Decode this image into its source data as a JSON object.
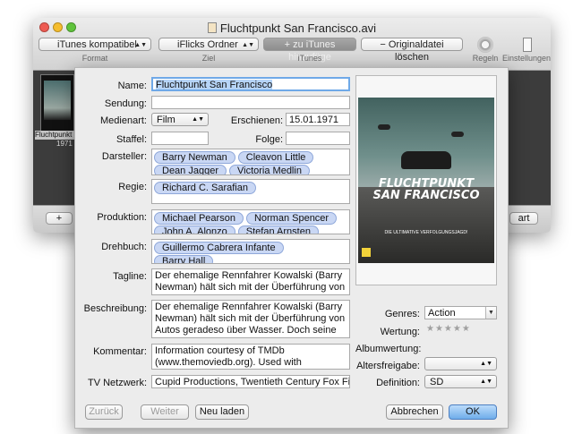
{
  "window": {
    "title": "Fluchtpunkt San Francisco.avi",
    "toolbar": {
      "format_value": "iTunes kompatibel",
      "format_caption": "Format",
      "ziel_value": "iFlicks Ordner",
      "ziel_caption": "Ziel",
      "itunes_add_label": "+ zu iTunes hinzufüge",
      "itunes_caption": "iTunes",
      "delete_original_label": "− Originaldatei löschen",
      "rules_label": "Regeln",
      "settings_label": "Einstellungen"
    },
    "list_item": {
      "name": "Fluchtpunkt San Francisco",
      "year": "1971"
    },
    "bottom_bar": {
      "add_label": "+",
      "start_label": "art"
    }
  },
  "sheet": {
    "labels": {
      "name": "Name:",
      "sendung": "Sendung:",
      "medienart": "Medienart:",
      "erschienen": "Erschienen:",
      "staffel": "Staffel:",
      "folge": "Folge:",
      "darsteller": "Darsteller:",
      "regie": "Regie:",
      "produktion": "Produktion:",
      "drehbuch": "Drehbuch:",
      "tagline": "Tagline:",
      "beschreibung": "Beschreibung:",
      "kommentar": "Kommentar:",
      "tv_netzwerk": "TV Netzwerk:",
      "genres": "Genres:",
      "wertung": "Wertung:",
      "albumwertung": "Albumwertung:",
      "altersfreigabe": "Altersfreigabe:",
      "definition": "Definition:"
    },
    "values": {
      "name": "Fluchtpunkt San Francisco",
      "sendung": "",
      "medienart": "Film",
      "erschienen": "15.01.1971",
      "staffel": "",
      "folge": "",
      "tagline": "Der ehemalige Rennfahrer Kowalski (Barry Newman) hält sich mit der Überführung von Autos geradeso über Wasser.",
      "beschreibung": "Der ehemalige Rennfahrer Kowalski (Barry Newman) hält sich mit der Überführung von Autos geradeso über Wasser. Doch seine Leidenschaft hat ihn nie ganz losgelassen und eines Tages will er es nochmal",
      "kommentar": "Information courtesy of TMDb (www.themoviedb.org). Used with permission.",
      "tv_netzwerk": "Cupid Productions, Twentieth Century Fox Film Corpo",
      "genres": "Action",
      "wertung_stars": "★★★★★",
      "altersfreigabe": "",
      "definition": "SD"
    },
    "darsteller": [
      "Barry Newman",
      "Cleavon Little",
      "Dean Jagger",
      "Victoria Medlin"
    ],
    "regie": [
      "Richard C. Sarafian"
    ],
    "produktion": [
      "Michael Pearson",
      "Norman Spencer",
      "John A. Alonzo",
      "Stefan Arnsten"
    ],
    "drehbuch": [
      "Guillermo Cabrera Infante",
      "Barry Hall"
    ],
    "poster": {
      "title_line1": "FLUCHTPUNKT",
      "title_line2": "SAN FRANCISCO",
      "tagline": "DIE ULTIMATIVE VERFOLGUNGSJAGD!"
    },
    "buttons": {
      "back": "Zurück",
      "next": "Weiter",
      "reload": "Neu laden",
      "cancel": "Abbrechen",
      "ok": "OK"
    },
    "colors": {
      "accent": "#6fa9e8",
      "token_bg": "#c9d7f4"
    }
  }
}
